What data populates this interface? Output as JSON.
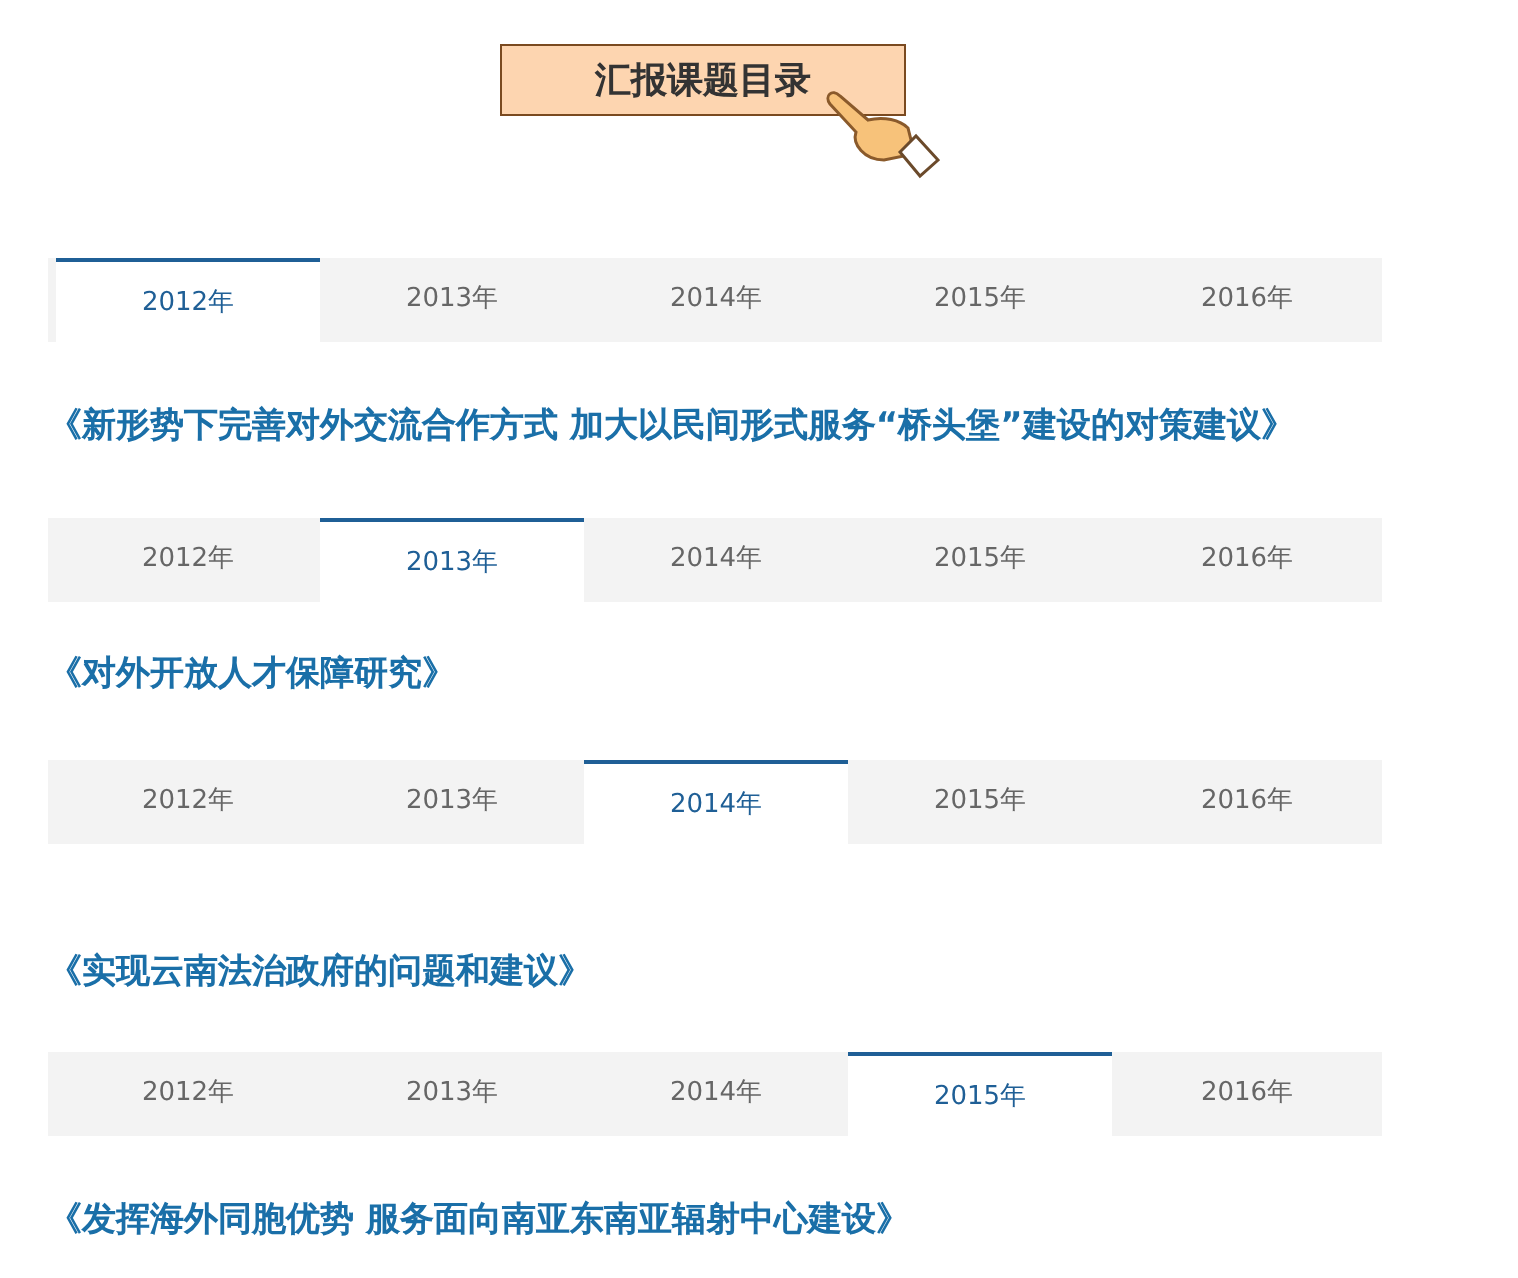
{
  "header": {
    "title": "汇报课题目录"
  },
  "sections": [
    {
      "tabs": [
        {
          "label": "2012年",
          "selected": true
        },
        {
          "label": "2013年",
          "selected": false
        },
        {
          "label": "2014年",
          "selected": false
        },
        {
          "label": "2015年",
          "selected": false
        },
        {
          "label": "2016年",
          "selected": false
        }
      ],
      "title": "《新形势下完善对外交流合作方式 加大以民间形式服务“桥头堡”建设的对策建议》"
    },
    {
      "tabs": [
        {
          "label": "2012年",
          "selected": false
        },
        {
          "label": "2013年",
          "selected": true
        },
        {
          "label": "2014年",
          "selected": false
        },
        {
          "label": "2015年",
          "selected": false
        },
        {
          "label": "2016年",
          "selected": false
        }
      ],
      "title": "《对外开放人才保障研究》"
    },
    {
      "tabs": [
        {
          "label": "2012年",
          "selected": false
        },
        {
          "label": "2013年",
          "selected": false
        },
        {
          "label": "2014年",
          "selected": true
        },
        {
          "label": "2015年",
          "selected": false
        },
        {
          "label": "2016年",
          "selected": false
        }
      ],
      "title": "《实现云南法治政府的问题和建议》"
    },
    {
      "tabs": [
        {
          "label": "2012年",
          "selected": false
        },
        {
          "label": "2013年",
          "selected": false
        },
        {
          "label": "2014年",
          "selected": false
        },
        {
          "label": "2015年",
          "selected": true
        },
        {
          "label": "2016年",
          "selected": false
        }
      ],
      "title": "《发挥海外同胞优势 服务面向南亚东南亚辐射中心建设》"
    }
  ]
}
